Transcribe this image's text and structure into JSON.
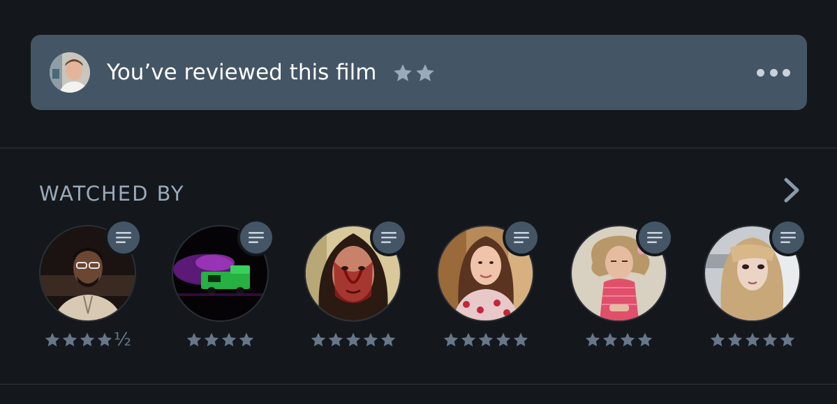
{
  "review_banner": {
    "text": "You’ve reviewed this film",
    "rating_stars": 2,
    "more_icon": "ellipsis-icon"
  },
  "watched_by": {
    "title": "WATCHED BY",
    "chevron_icon": "chevron-right-icon",
    "members": [
      {
        "rating_stars": 4,
        "half_star": true,
        "half_glyph": "½",
        "avatar": "man-with-glasses-photo"
      },
      {
        "rating_stars": 4,
        "half_star": false,
        "avatar": "neon-ice-cream-truck-photo"
      },
      {
        "rating_stars": 5,
        "half_star": false,
        "avatar": "blood-covered-woman-photo"
      },
      {
        "rating_stars": 5,
        "half_star": false,
        "avatar": "smiling-woman-photo"
      },
      {
        "rating_stars": 4,
        "half_star": false,
        "avatar": "claymation-doll-photo"
      },
      {
        "rating_stars": 5,
        "half_star": false,
        "avatar": "blonde-woman-photo"
      }
    ]
  },
  "colors": {
    "background": "#14181c",
    "banner": "#445566",
    "banner_star": "#99aabb",
    "rating_star": "#66778a",
    "section_title": "#9aaabb"
  }
}
